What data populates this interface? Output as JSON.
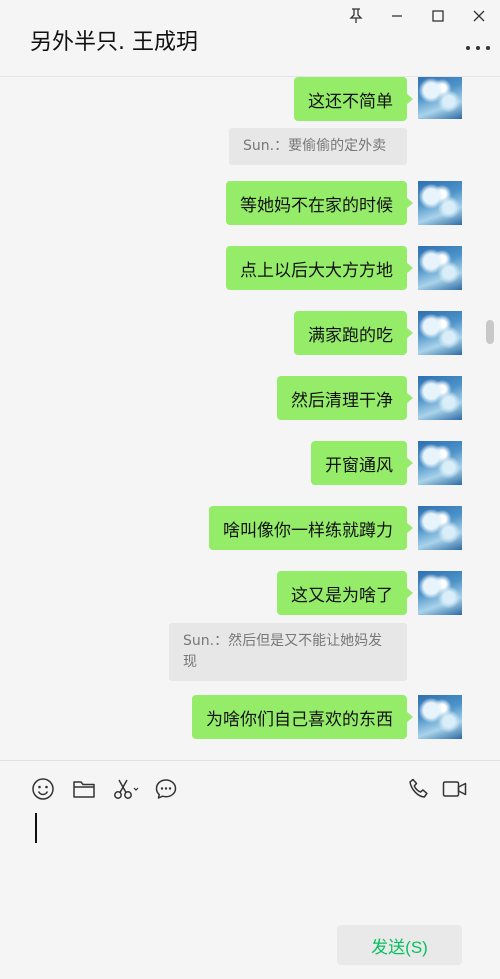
{
  "window": {
    "title": "另外半只. 王成玥"
  },
  "messages": [
    {
      "type": "sent",
      "text": "这还不简单"
    },
    {
      "type": "quote",
      "text": "Sun.：要偷偷的定外卖"
    },
    {
      "type": "sent",
      "text": "等她妈不在家的时候"
    },
    {
      "type": "sent",
      "text": "点上以后大大方方地"
    },
    {
      "type": "sent",
      "text": "满家跑的吃"
    },
    {
      "type": "sent",
      "text": "然后清理干净"
    },
    {
      "type": "sent",
      "text": "开窗通风"
    },
    {
      "type": "sent",
      "text": "啥叫像你一样练就蹲力"
    },
    {
      "type": "sent",
      "text": "这又是为啥了"
    },
    {
      "type": "quote",
      "text": "Sun.：然后但是又不能让她妈发现"
    },
    {
      "type": "sent",
      "text": "为啥你们自己喜欢的东西"
    }
  ],
  "composer": {
    "send_label": "发送(S)"
  },
  "colors": {
    "bubble_sent": "#95ec69",
    "send_text": "#07c160"
  }
}
